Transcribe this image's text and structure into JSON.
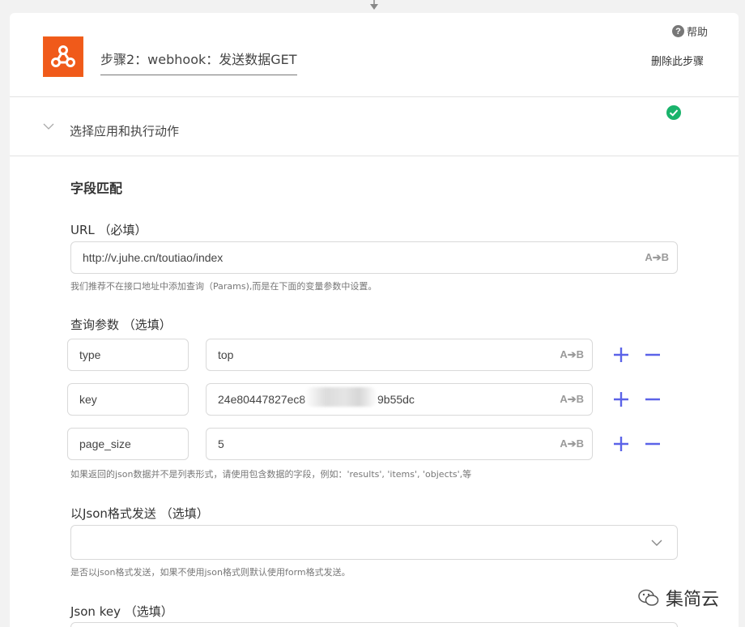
{
  "step": {
    "title": "步骤2：webhook：发送数据GET",
    "help": "帮助",
    "delete": "删除此步骤"
  },
  "section": {
    "title": "选择应用和执行动作"
  },
  "fields": {
    "heading": "字段匹配",
    "url_label": "URL （必填）",
    "url_value": "http://v.juhe.cn/toutiao/index",
    "url_hint": "我们推荐不在接口地址中添加查询（Params),而是在下面的变量参数中设置。",
    "query_label": "查询参数 （选填）",
    "params": [
      {
        "key": "type",
        "value": "top"
      },
      {
        "key": "key",
        "value_start": "24e80447827ec8",
        "value_end": "9b55dc"
      },
      {
        "key": "page_size",
        "value": "5"
      }
    ],
    "params_hint": "如果返回的json数据并不是列表形式，请使用包含数据的字段，例如：'results', 'items', 'objects',等",
    "json_label": "以Json格式发送 （选填）",
    "json_value": "",
    "json_hint": "是否以json格式发送，如果不使用json格式则默认使用form格式发送。",
    "json_key_label": "Json key （选填）",
    "ab_text": "A➔B"
  },
  "watermark": {
    "text": "集简云"
  },
  "colors": {
    "accent": "#5b63e8",
    "success": "#19b36b",
    "brand": "#f05a1a"
  }
}
